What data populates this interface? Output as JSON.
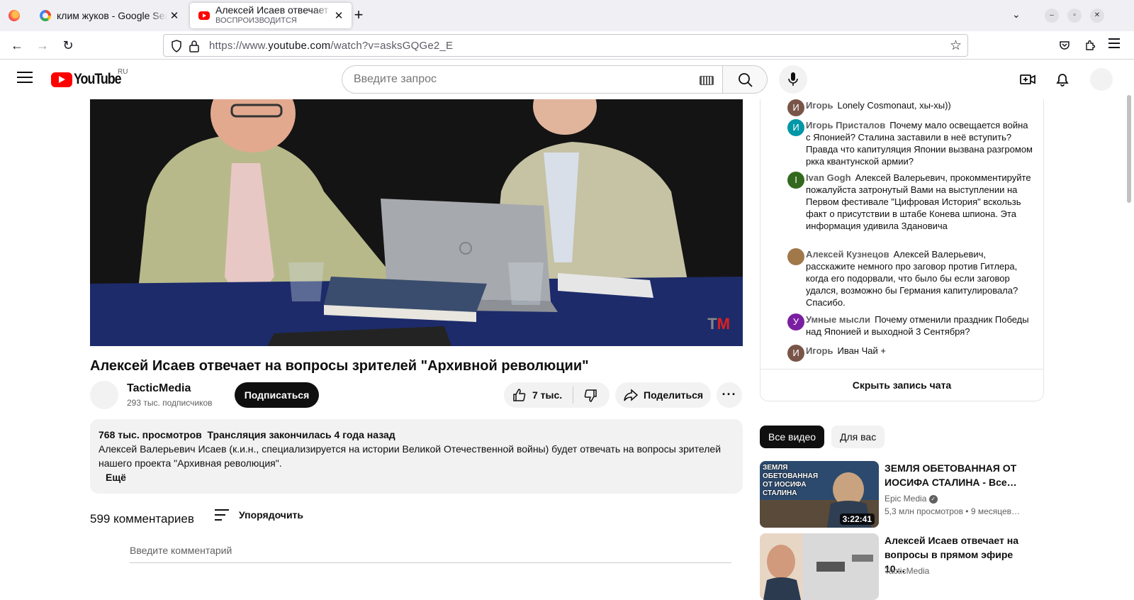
{
  "browser": {
    "tabs": [
      {
        "title": "клим жуков - Google Search"
      },
      {
        "title": "Алексей Исаев отвечает на вопросы",
        "subtitle": "ВОСПРОИЗВОДИТСЯ"
      }
    ],
    "url_prefix": "https://www.",
    "url_domain": "youtube.com",
    "url_path": "/watch?v=asksGQGe2_E"
  },
  "yt": {
    "logo": "YouTube",
    "region": "RU",
    "search_placeholder": "Введите запрос"
  },
  "video": {
    "title": "Алексей Исаев отвечает на вопросы зрителей \"Архивной революции\"",
    "watermark_t": "T",
    "watermark_m": "M",
    "channel": "TacticMedia",
    "subscribers": "293 тыс. подписчиков",
    "subscribe_label": "Подписаться",
    "likes": "7 тыс.",
    "share_label": "Поделиться",
    "views": "768 тыс. просмотров",
    "stream_ended": "Трансляция закончилась 4 года назад",
    "description": "Алексей Валерьевич Исаев (к.и.н., специализируется на истории Великой Отечественной войны) будет отвечать на вопросы зрителей нашего проекта \"Архивная революция\".",
    "more_label": "Ещё"
  },
  "comments": {
    "count": "599 комментариев",
    "sort_label": "Упорядочить",
    "input_placeholder": "Введите комментарий"
  },
  "chat": {
    "messages": [
      {
        "initial": "И",
        "color": "#795548",
        "author": "Игорь",
        "text": "Lonely Cosmonaut, хы-хы))"
      },
      {
        "initial": "И",
        "color": "#0097a7",
        "author": "Игорь Присталов",
        "text": "Почему мало освещается война с Японией? Сталина заставили в неё вступить? Правда что капитуляция Японии вызвана разгромом ркка квантунской армии?"
      },
      {
        "initial": "I",
        "color": "#33691e",
        "author": "Ivan Gogh",
        "text": "Алексей Валерьевич, прокомментируйте пожалуйста затронутый Вами на выступлении на Первом фестивале \"Цифровая История\" вскользь факт о присутствии в штабе Конева шпиона. Эта информация удивила Здановича"
      },
      {
        "initial": "",
        "color": "#a0784a",
        "author": "Алексей Кузнецов",
        "text": "Алексей Валерьевич, расскажите немного про заговор против Гитлера, когда его подорвали, что было бы если заговор удался, возможно бы Германия капитулировала? Спасибо."
      },
      {
        "initial": "У",
        "color": "#7b1fa2",
        "author": "Умные мысли",
        "text": "Почему отменили праздник Победы над Японией и выходной 3 Сентября?"
      },
      {
        "initial": "И",
        "color": "#795548",
        "author": "Игорь",
        "text": "Иван Чай +"
      }
    ],
    "hide_label": "Скрыть запись чата"
  },
  "chips": {
    "all": "Все видео",
    "for_you": "Для вас"
  },
  "recommendations": [
    {
      "title": "ЗЕМЛЯ ОБЕТОВАННАЯ ОТ ИОСИФА СТАЛИНА - Все…",
      "channel": "Epic Media",
      "meta": "5,3 млн просмотров • 9 месяцев…",
      "duration": "3:22:41",
      "thumb_text": "ЗЕМЛЯ ОБЕТОВАННАЯ ОТ ИОСИФА СТАЛИНА"
    },
    {
      "title": "Алексей Исаев отвечает на вопросы в прямом эфире 10…",
      "channel": "TacticMedia",
      "meta": "",
      "duration": ""
    }
  ]
}
